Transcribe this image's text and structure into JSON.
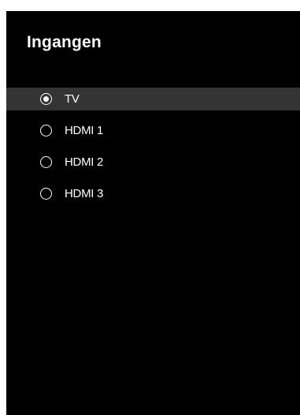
{
  "menu": {
    "title": "Ingangen",
    "items": [
      {
        "label": "TV",
        "selected": true
      },
      {
        "label": "HDMI 1",
        "selected": false
      },
      {
        "label": "HDMI 2",
        "selected": false
      },
      {
        "label": "HDMI 3",
        "selected": false
      }
    ]
  },
  "colors": {
    "panel_background": "#000000",
    "highlight_background": "#343434",
    "text": "#ffffff"
  },
  "icons": {
    "selected_radio": "radio-checked-icon",
    "unselected_radio": "radio-unchecked-icon"
  }
}
